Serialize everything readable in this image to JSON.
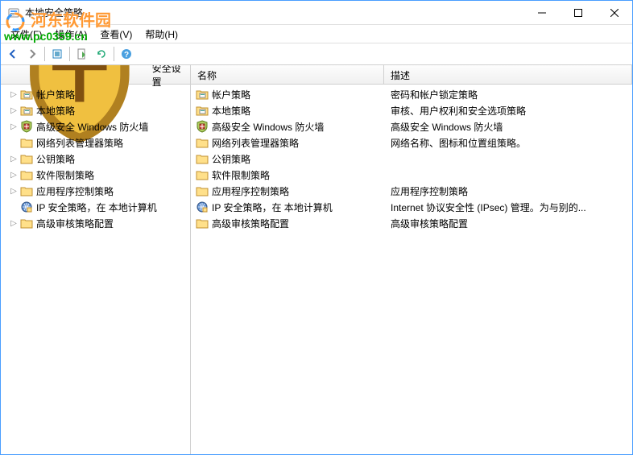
{
  "window": {
    "title": "本地安全策略"
  },
  "menu": {
    "file": "文件(F)",
    "action": "操作(A)",
    "view": "查看(V)",
    "help": "帮助(H)"
  },
  "watermark": {
    "line1": "河东软件园",
    "line2": "www.pc0359.cn"
  },
  "tree": {
    "header": "安全设置",
    "root_icon": "security-root",
    "items": [
      {
        "label": "帐户策略",
        "icon": "folder-policy",
        "expandable": true
      },
      {
        "label": "本地策略",
        "icon": "folder-policy",
        "expandable": true
      },
      {
        "label": "高级安全 Windows 防火墙",
        "icon": "firewall",
        "expandable": true
      },
      {
        "label": "网络列表管理器策略",
        "icon": "folder",
        "expandable": false
      },
      {
        "label": "公钥策略",
        "icon": "folder",
        "expandable": true
      },
      {
        "label": "软件限制策略",
        "icon": "folder",
        "expandable": true
      },
      {
        "label": "应用程序控制策略",
        "icon": "folder",
        "expandable": true
      },
      {
        "label": "IP 安全策略，在 本地计算机",
        "icon": "ipsec",
        "expandable": false
      },
      {
        "label": "高级审核策略配置",
        "icon": "folder",
        "expandable": true
      }
    ]
  },
  "list": {
    "columns": {
      "name": "名称",
      "desc": "描述"
    },
    "rows": [
      {
        "name": "帐户策略",
        "desc": "密码和帐户锁定策略",
        "icon": "folder-policy"
      },
      {
        "name": "本地策略",
        "desc": "审核、用户权利和安全选项策略",
        "icon": "folder-policy"
      },
      {
        "name": "高级安全 Windows 防火墙",
        "desc": "高级安全 Windows 防火墙",
        "icon": "firewall"
      },
      {
        "name": "网络列表管理器策略",
        "desc": "网络名称、图标和位置组策略。",
        "icon": "folder"
      },
      {
        "name": "公钥策略",
        "desc": "",
        "icon": "folder"
      },
      {
        "name": "软件限制策略",
        "desc": "",
        "icon": "folder"
      },
      {
        "name": "应用程序控制策略",
        "desc": "应用程序控制策略",
        "icon": "folder"
      },
      {
        "name": "IP 安全策略，在 本地计算机",
        "desc": "Internet 协议安全性 (IPsec) 管理。为与别的...",
        "icon": "ipsec"
      },
      {
        "name": "高级审核策略配置",
        "desc": "高级审核策略配置",
        "icon": "folder"
      }
    ]
  }
}
